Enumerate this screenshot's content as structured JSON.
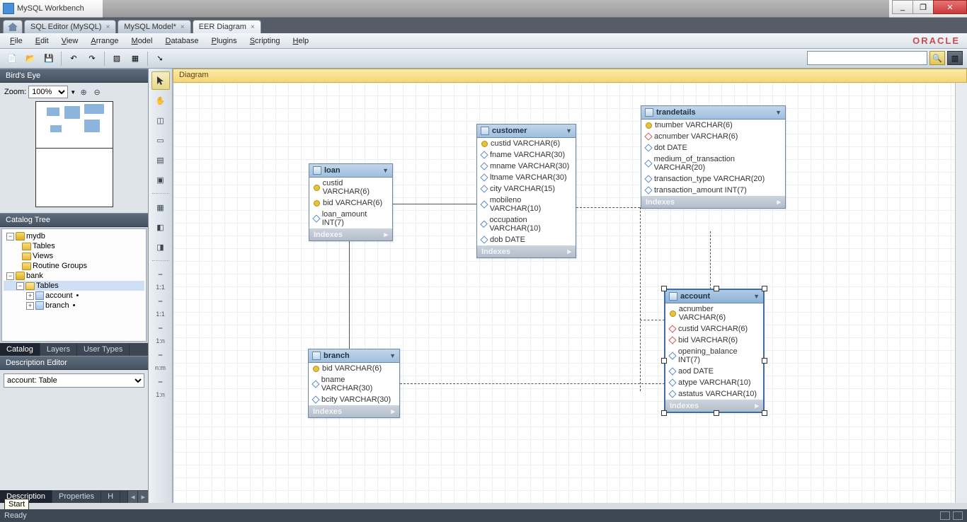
{
  "titlebar": {
    "title": "MySQL Workbench"
  },
  "window_buttons": {
    "min": "_",
    "max": "❐",
    "close": "✕"
  },
  "doctabs": {
    "home": "home",
    "tabs": [
      {
        "label": "SQL Editor (MySQL)",
        "closable": true,
        "active": false
      },
      {
        "label": "MySQL Model*",
        "closable": true,
        "active": false
      },
      {
        "label": "EER Diagram",
        "closable": true,
        "active": true
      }
    ]
  },
  "menu": [
    "File",
    "Edit",
    "View",
    "Arrange",
    "Model",
    "Database",
    "Plugins",
    "Scripting",
    "Help"
  ],
  "brand": "ORACLE",
  "toolbar_icons": [
    "new-file",
    "open-file",
    "save",
    "undo",
    "redo",
    "validate",
    "grid",
    "export"
  ],
  "birds_eye": {
    "title": "Bird's Eye",
    "zoom_label": "Zoom:",
    "zoom_value": "100%"
  },
  "catalog": {
    "title": "Catalog Tree",
    "tree": {
      "mydb": {
        "label": "mydb",
        "children": [
          "Tables",
          "Views",
          "Routine Groups"
        ]
      },
      "bank": {
        "label": "bank",
        "tables_label": "Tables",
        "tables": [
          "account",
          "branch"
        ]
      }
    },
    "tabs": [
      "Catalog",
      "Layers",
      "User Types"
    ]
  },
  "description": {
    "title": "Description Editor",
    "value": "account: Table",
    "tabs": [
      "Description",
      "Properties",
      "H"
    ]
  },
  "toolstrip_labels": [
    "1:1",
    "1:1",
    "1:n",
    "n:m",
    "1:n"
  ],
  "canvas_title": "Diagram",
  "tables": {
    "loan": {
      "name": "loan",
      "cols": [
        {
          "k": "pk",
          "text": "custid VARCHAR(6)"
        },
        {
          "k": "pk",
          "text": "bid VARCHAR(6)"
        },
        {
          "k": "db",
          "text": "loan_amount INT(7)"
        }
      ],
      "indexes": "Indexes"
    },
    "customer": {
      "name": "customer",
      "cols": [
        {
          "k": "pk",
          "text": "custid VARCHAR(6)"
        },
        {
          "k": "db",
          "text": "fname VARCHAR(30)"
        },
        {
          "k": "db",
          "text": "mname VARCHAR(30)"
        },
        {
          "k": "db",
          "text": "ltname VARCHAR(30)"
        },
        {
          "k": "db",
          "text": "city VARCHAR(15)"
        },
        {
          "k": "db",
          "text": "mobileno VARCHAR(10)"
        },
        {
          "k": "db",
          "text": "occupation VARCHAR(10)"
        },
        {
          "k": "db",
          "text": "dob DATE"
        }
      ],
      "indexes": "Indexes"
    },
    "trandetails": {
      "name": "trandetails",
      "cols": [
        {
          "k": "pk",
          "text": "tnumber VARCHAR(6)"
        },
        {
          "k": "dr",
          "text": "acnumber VARCHAR(6)"
        },
        {
          "k": "db",
          "text": "dot DATE"
        },
        {
          "k": "db",
          "text": "medium_of_transaction VARCHAR(20)"
        },
        {
          "k": "db",
          "text": "transaction_type VARCHAR(20)"
        },
        {
          "k": "db",
          "text": "transaction_amount INT(7)"
        }
      ],
      "indexes": "Indexes"
    },
    "branch": {
      "name": "branch",
      "cols": [
        {
          "k": "pk",
          "text": "bid VARCHAR(6)"
        },
        {
          "k": "db",
          "text": "bname VARCHAR(30)"
        },
        {
          "k": "db",
          "text": "bcity VARCHAR(30)"
        }
      ],
      "indexes": "Indexes"
    },
    "account": {
      "name": "account",
      "cols": [
        {
          "k": "pk",
          "text": "acnumber VARCHAR(6)"
        },
        {
          "k": "dr",
          "text": "custid VARCHAR(6)"
        },
        {
          "k": "dr",
          "text": "bid VARCHAR(6)"
        },
        {
          "k": "db",
          "text": "opening_balance INT(7)"
        },
        {
          "k": "db",
          "text": "aod DATE"
        },
        {
          "k": "db",
          "text": "atype VARCHAR(10)"
        },
        {
          "k": "db",
          "text": "astatus VARCHAR(10)"
        }
      ],
      "indexes": "Indexes"
    }
  },
  "start_tooltip": "Start",
  "status": "Ready"
}
